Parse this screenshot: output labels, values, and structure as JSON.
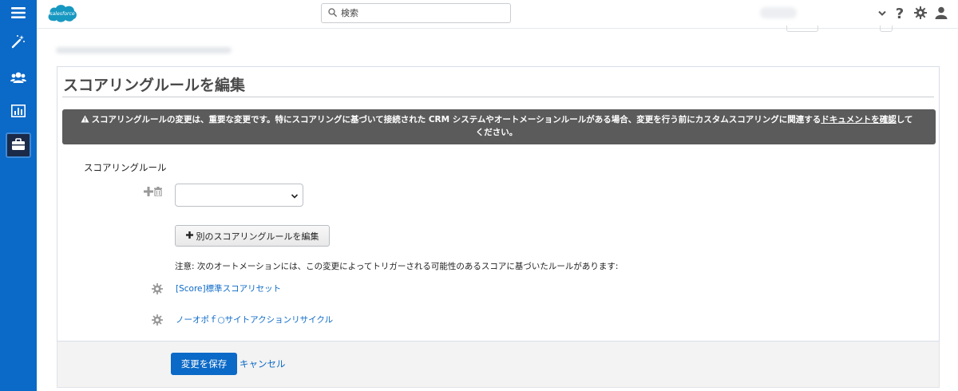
{
  "header": {
    "logo_text": "salesforce",
    "search_placeholder": "検索",
    "help_label": "?",
    "icons": [
      "chevron-down-icon",
      "help-icon",
      "gear-icon",
      "user-icon"
    ]
  },
  "sidebar": {
    "items": [
      {
        "icon": "menu-icon",
        "active": false
      },
      {
        "icon": "magic-wand-icon",
        "active": false
      },
      {
        "icon": "users-icon",
        "active": false
      },
      {
        "icon": "report-icon",
        "active": false
      },
      {
        "icon": "briefcase-icon",
        "active": true
      }
    ]
  },
  "page": {
    "title": "スコアリングルールを編集",
    "warning_text": "スコアリングルールの変更は、重要な変更です。特にスコアリングに基づいて接続された CRM システムやオートメーションルールがある場合、変更を行う前にカスタムスコアリングに関連する",
    "warning_link": "ドキュメントを確認",
    "warning_suffix": "してください。",
    "field_label": "スコアリングルール",
    "select_value": "",
    "edit_other_button": "別のスコアリングルールを編集",
    "note": "注意: 次のオートメーションには、この変更によってトリガーされる可能性のあるスコアに基づいたルールがあります:",
    "automations": [
      {
        "label": "[Score]標準スコアリセット"
      },
      {
        "label": "ノーオポｆ○サイトアクションリサイクル"
      }
    ]
  },
  "footer": {
    "save_button": "変更を保存",
    "cancel_link": "キャンセル"
  },
  "colors": {
    "nav_bg": "#0b69c7",
    "warning_bg": "#5b5b5b",
    "link": "#0b69c7",
    "primary_button": "#0b69c7"
  }
}
